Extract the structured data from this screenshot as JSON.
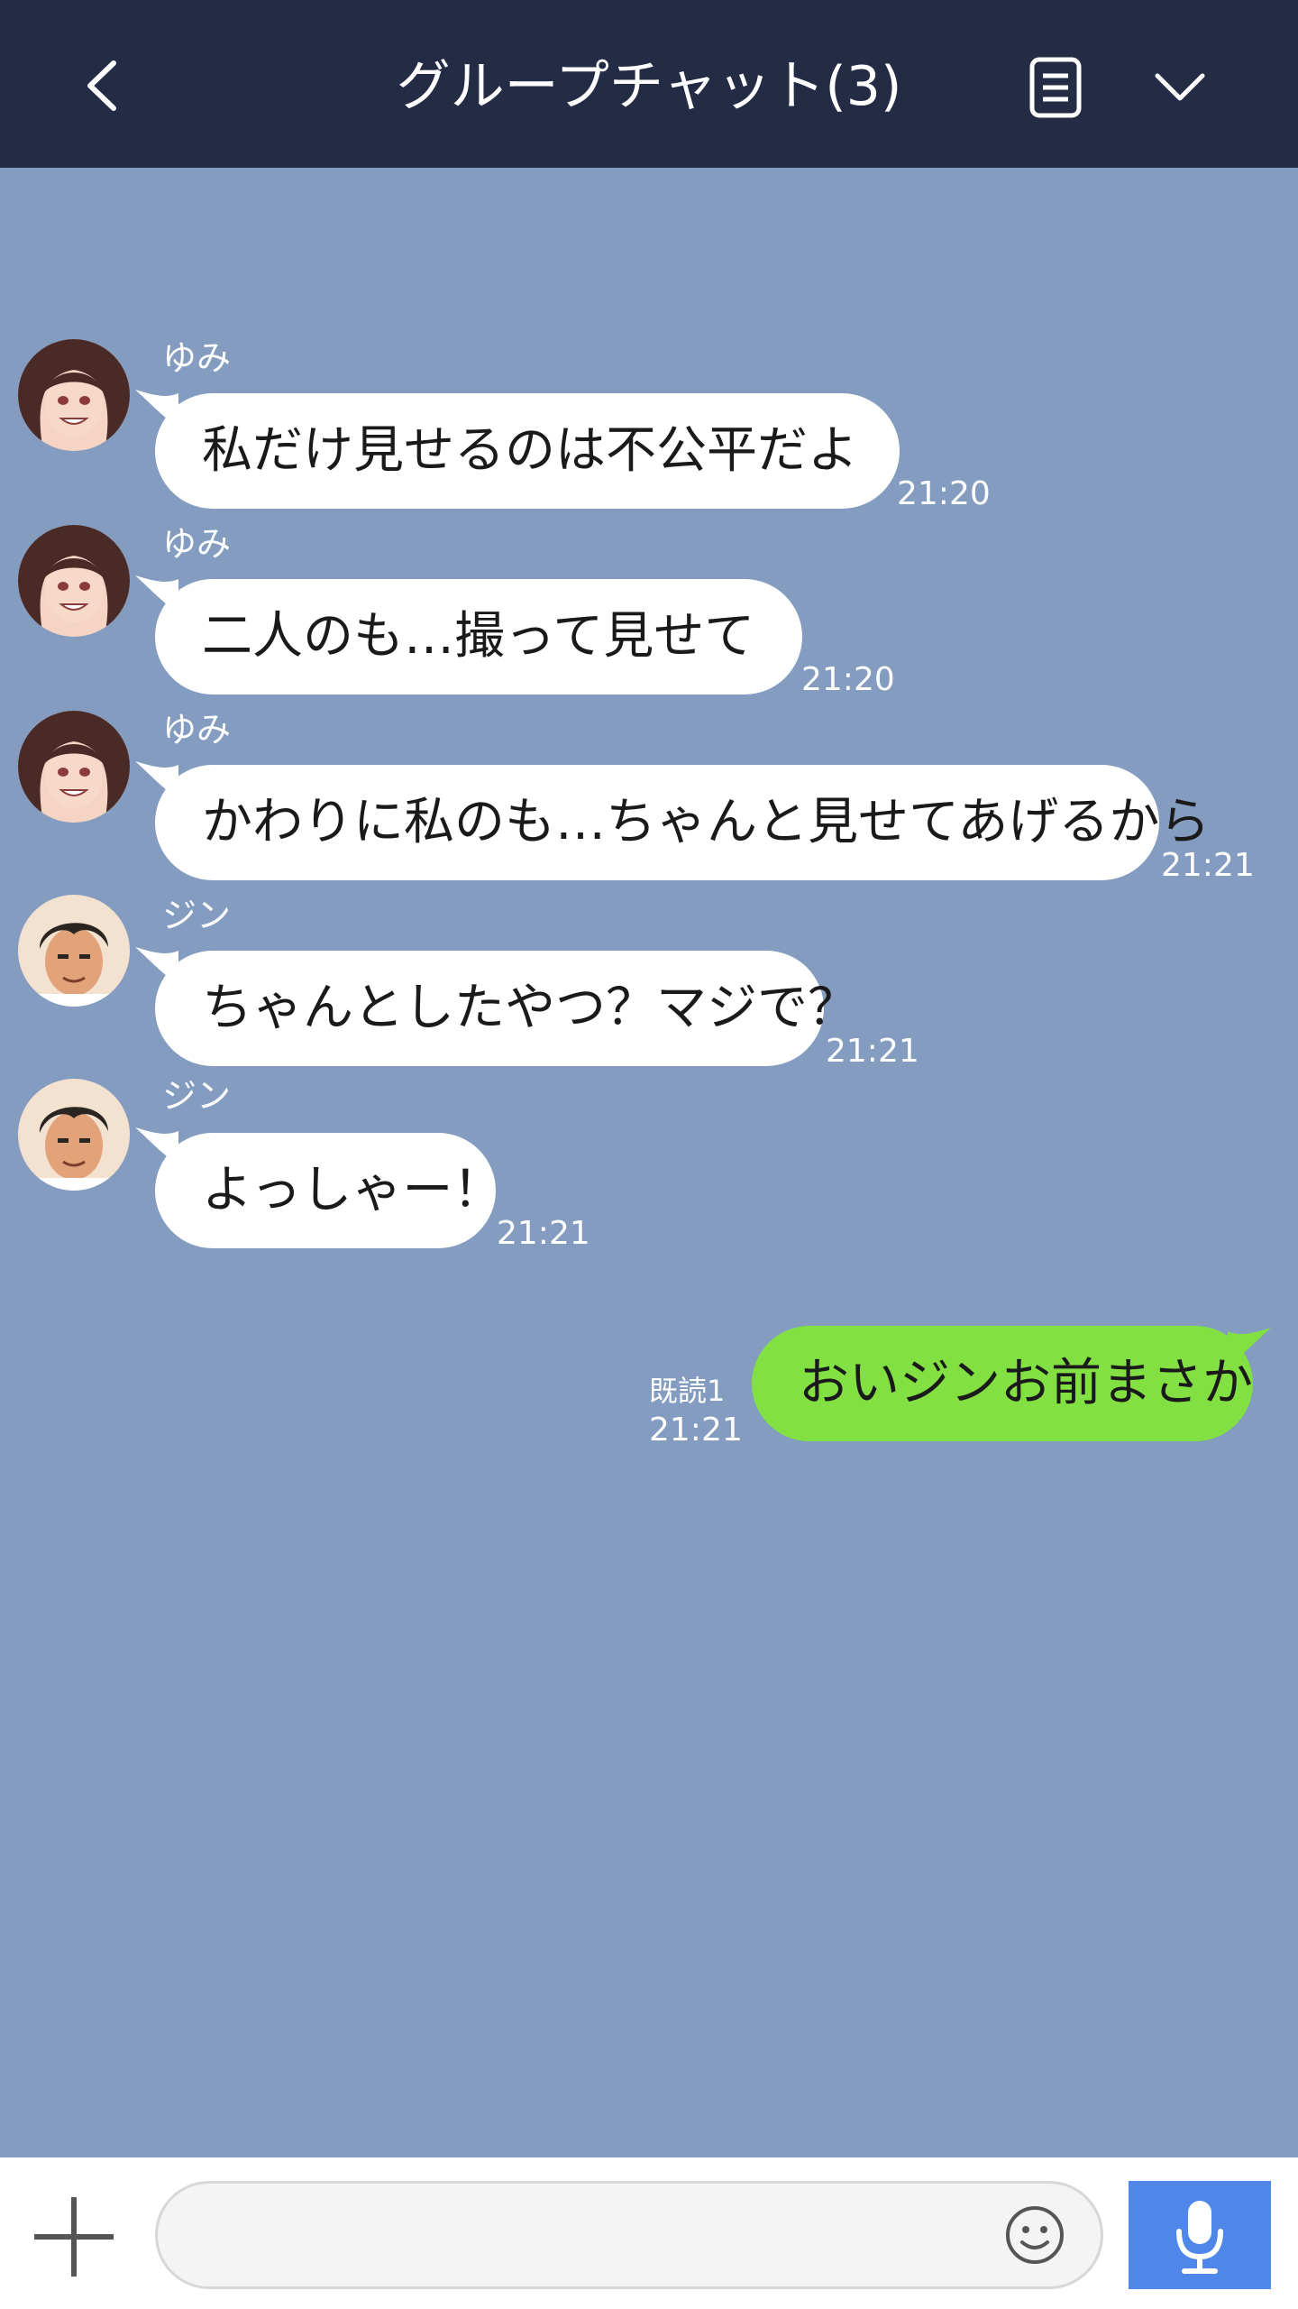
{
  "header": {
    "title": "グループチャット(3)",
    "background": "#232b45",
    "icons": [
      "back-chevron",
      "notes",
      "chevron-down"
    ]
  },
  "chat": {
    "background": "#839cbf",
    "messages": [
      {
        "sender": "ゆみ",
        "text": "私だけ見せるのは不公平だよ",
        "time": "21:20"
      },
      {
        "sender": "ゆみ",
        "text": "二人のも…撮って見せて",
        "time": "21:20"
      },
      {
        "sender": "ゆみ",
        "text": "かわりに私のも…ちゃんと見せてあげるから",
        "time": "21:21"
      },
      {
        "sender": "ジン",
        "text": "ちゃんとしたやつ？マジで？",
        "time": "21:21"
      },
      {
        "sender": "ジン",
        "text": "よっしゃー！",
        "time": "21:21"
      }
    ],
    "own_message": {
      "text": "おいジンお前まさか",
      "read_label": "既読1",
      "time": "21:21",
      "color": "#83e043"
    }
  },
  "composer": {
    "input_value": "",
    "icons": [
      "plus",
      "smiley",
      "microphone"
    ],
    "mic_color": "#4f86ea"
  }
}
